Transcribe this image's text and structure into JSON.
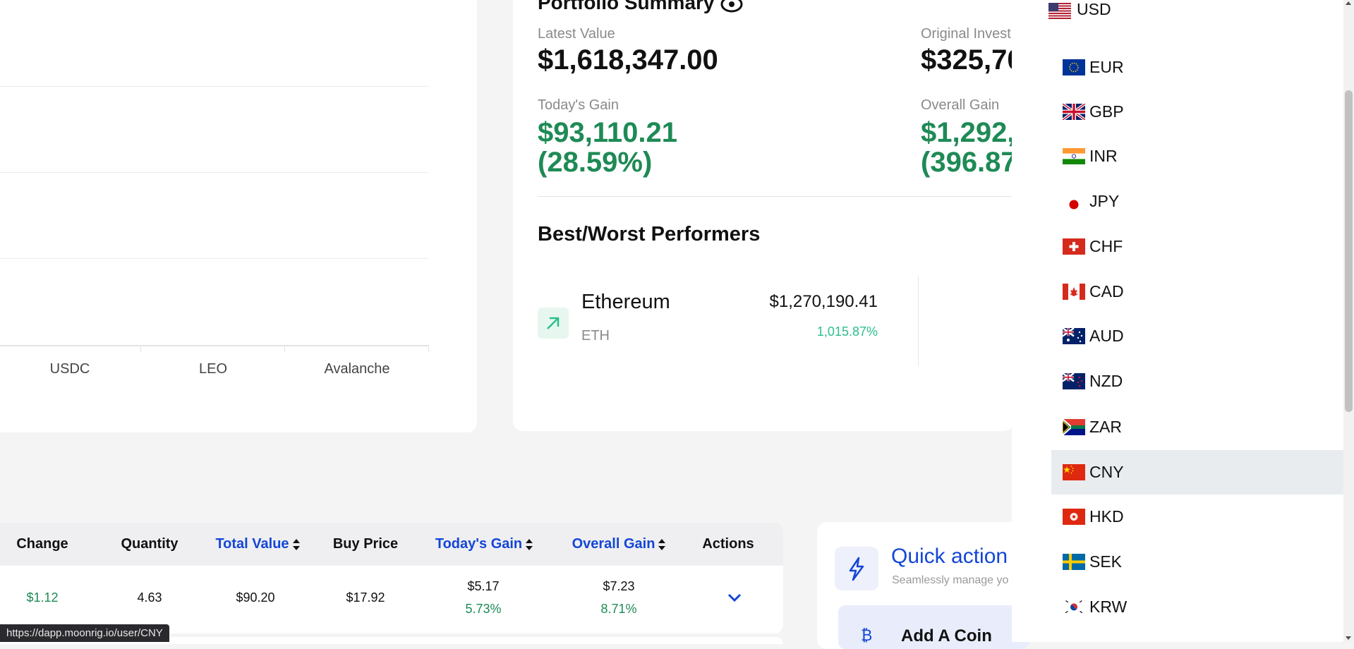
{
  "chart": {
    "x_labels": [
      "USDC",
      "LEO",
      "Avalanche"
    ]
  },
  "portfolio": {
    "title": "Portfolio Summary",
    "latest_value_label": "Latest Value",
    "latest_value": "$1,618,347.00",
    "original_investment_label": "Original Invest",
    "original_investment": "$325,70",
    "todays_gain_label": "Today's Gain",
    "todays_gain": "$93,110.21",
    "todays_gain_pct": "(28.59%)",
    "overall_gain_label": "Overall Gain",
    "overall_gain": "$1,292,6",
    "overall_gain_pct": "(396.87",
    "performers_title": "Best/Worst Performers",
    "best": {
      "name": "Ethereum",
      "symbol": "ETH",
      "value": "$1,270,190.41",
      "pct": "1,015.87%"
    }
  },
  "table": {
    "headers": {
      "change": "Change",
      "quantity": "Quantity",
      "total_value": "Total Value",
      "buy_price": "Buy Price",
      "todays_gain": "Today's Gain",
      "overall_gain": "Overall Gain",
      "actions": "Actions"
    },
    "row": {
      "change": "$1.12",
      "quantity": "4.63",
      "total_value": "$90.20",
      "buy_price": "$17.92",
      "todays_gain": "$5.17",
      "todays_gain_pct": "5.73%",
      "overall_gain": "$7.23",
      "overall_gain_pct": "8.71%"
    }
  },
  "quick_actions": {
    "title": "Quick action",
    "subtitle": "Seamlessly manage yo",
    "add_coin": "Add A Coin"
  },
  "currency": {
    "selected_top": "USD",
    "items": [
      "EUR",
      "GBP",
      "INR",
      "JPY",
      "CHF",
      "CAD",
      "AUD",
      "NZD",
      "ZAR",
      "CNY",
      "HKD",
      "SEK",
      "KRW"
    ],
    "highlighted": "CNY"
  },
  "status_url": "https://dapp.moonrig.io/user/CNY",
  "colors": {
    "gain_green": "#1e8a55",
    "accent_blue": "#1346d6",
    "pct_teal": "#2bbf8a"
  }
}
